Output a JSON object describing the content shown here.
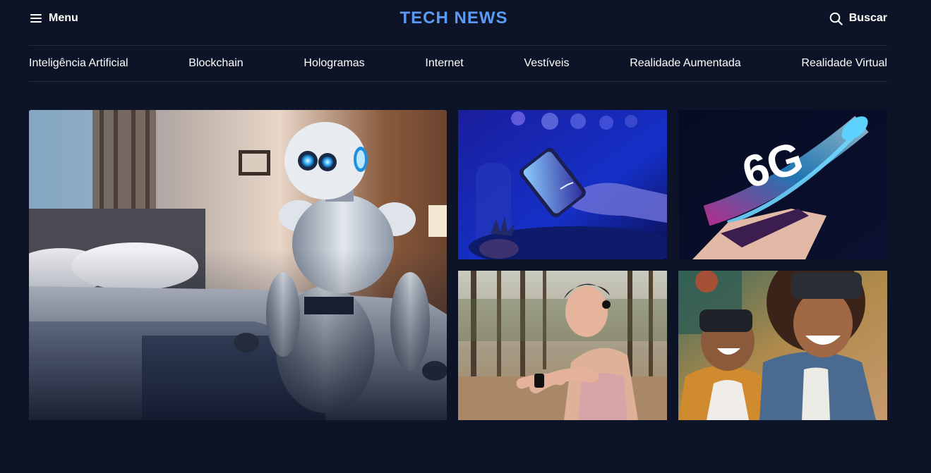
{
  "header": {
    "menu_label": "Menu",
    "menu_icon": "hamburger-icon",
    "brand": "TECH NEWS",
    "search_label": "Buscar",
    "search_icon": "search-icon"
  },
  "nav": {
    "items": [
      {
        "label": "Inteligência Artificial"
      },
      {
        "label": "Blockchain"
      },
      {
        "label": "Hologramas"
      },
      {
        "label": "Internet"
      },
      {
        "label": "Vestíveis"
      },
      {
        "label": "Realidade Aumentada"
      },
      {
        "label": "Realidade Virtual"
      }
    ]
  },
  "colors": {
    "background": "#0d1427",
    "brand": "#5b9bf6",
    "text": "#ffffff",
    "divider": "#232b40"
  }
}
